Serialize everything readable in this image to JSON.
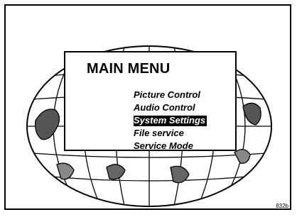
{
  "menu": {
    "title": "MAIN MENU",
    "items": [
      {
        "label": "Picture Control",
        "selected": false
      },
      {
        "label": "Audio Control",
        "selected": false
      },
      {
        "label": "System Settings",
        "selected": true
      },
      {
        "label": "File service",
        "selected": false
      },
      {
        "label": "Service Mode",
        "selected": false
      }
    ]
  },
  "figure_ref": "832b",
  "colors": {
    "foreground": "#000000",
    "background": "#ffffff",
    "selection": "#000000"
  },
  "icons": {
    "background": "world-map-globe-icon"
  }
}
